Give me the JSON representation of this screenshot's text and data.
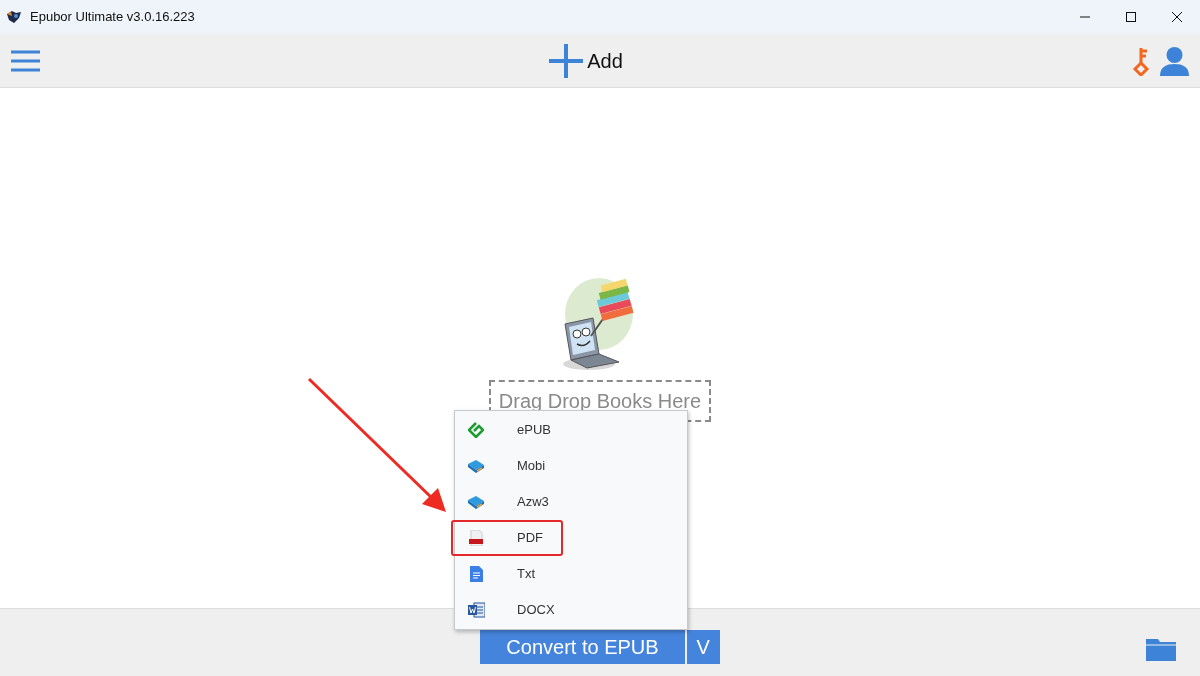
{
  "window": {
    "title": "Epubor Ultimate v3.0.16.223"
  },
  "toolbar": {
    "add_label": "Add"
  },
  "drop_zone": {
    "label": "Drag Drop Books Here"
  },
  "format_menu": {
    "items": [
      {
        "kind": "epub",
        "label": "ePUB",
        "highlighted": false
      },
      {
        "kind": "book",
        "label": "Mobi",
        "highlighted": false
      },
      {
        "kind": "book",
        "label": "Azw3",
        "highlighted": false
      },
      {
        "kind": "pdf",
        "label": "PDF",
        "highlighted": true
      },
      {
        "kind": "txt",
        "label": "Txt",
        "highlighted": false
      },
      {
        "kind": "word",
        "label": "DOCX",
        "highlighted": false
      }
    ]
  },
  "convert_button": {
    "label": "Convert to EPUB",
    "caret": "V"
  }
}
